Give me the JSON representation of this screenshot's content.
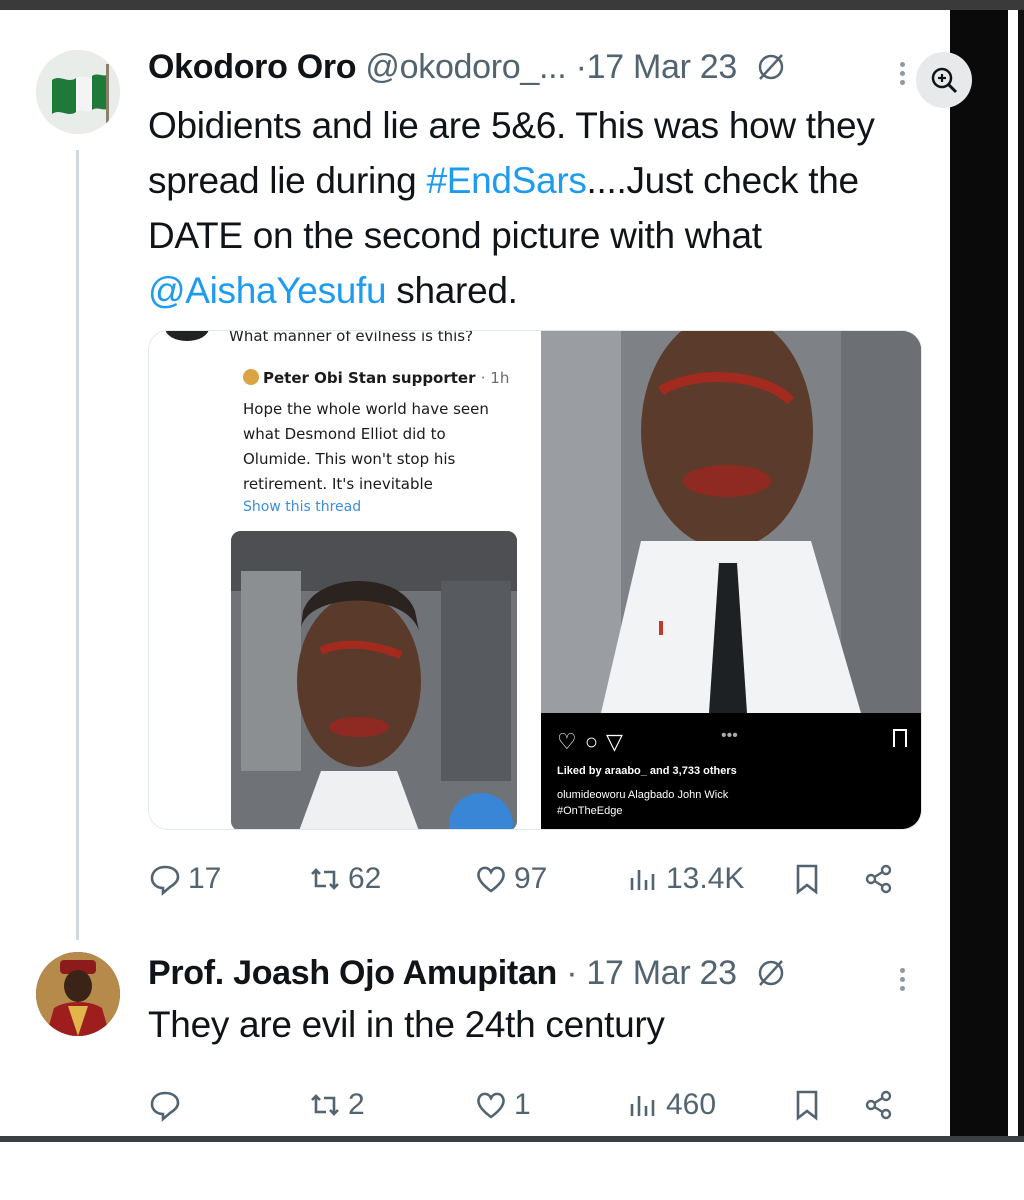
{
  "tweet": {
    "author_name": "Okodoro Oro",
    "handle": "@okodoro_...",
    "separator": "·",
    "date": "17 Mar 23",
    "text_part1": "Obidients and lie are 5&6. This was how they spread lie during ",
    "hashtag": "#EndSars",
    "text_part2": "....Just check the DATE on the second picture with what ",
    "mention": "@AishaYesufu",
    "text_part3": " shared.",
    "media": {
      "left_screenshot": {
        "top_text": "What manner of evilness is this?",
        "poster_name": "Peter Obi Stan supporter",
        "poster_time": "· 1h",
        "body": "Hope the whole world have seen what Desmond Elliot did to Olumide. This won't stop his retirement. It's inevitable",
        "show_thread": "Show this thread"
      },
      "right_instagram": {
        "liked_by": "Liked by araabo_ and 3,733 others",
        "caption_line1": "olumideoworu Alagbado John Wick",
        "caption_line2": "#OnTheEdge"
      }
    },
    "stats": {
      "replies": "17",
      "retweets": "62",
      "likes": "97",
      "views": "13.4K"
    }
  },
  "reply": {
    "author_name": "Prof. Joash Ojo Amupitan",
    "separator": "·",
    "date": "17 Mar 23",
    "text": "They are evil in the 24th century",
    "stats": {
      "replies": "",
      "retweets": "2",
      "likes": "1",
      "views": "460"
    }
  },
  "colors": {
    "link": "#1d9bf0",
    "muted": "#536471",
    "text": "#0f1419"
  }
}
